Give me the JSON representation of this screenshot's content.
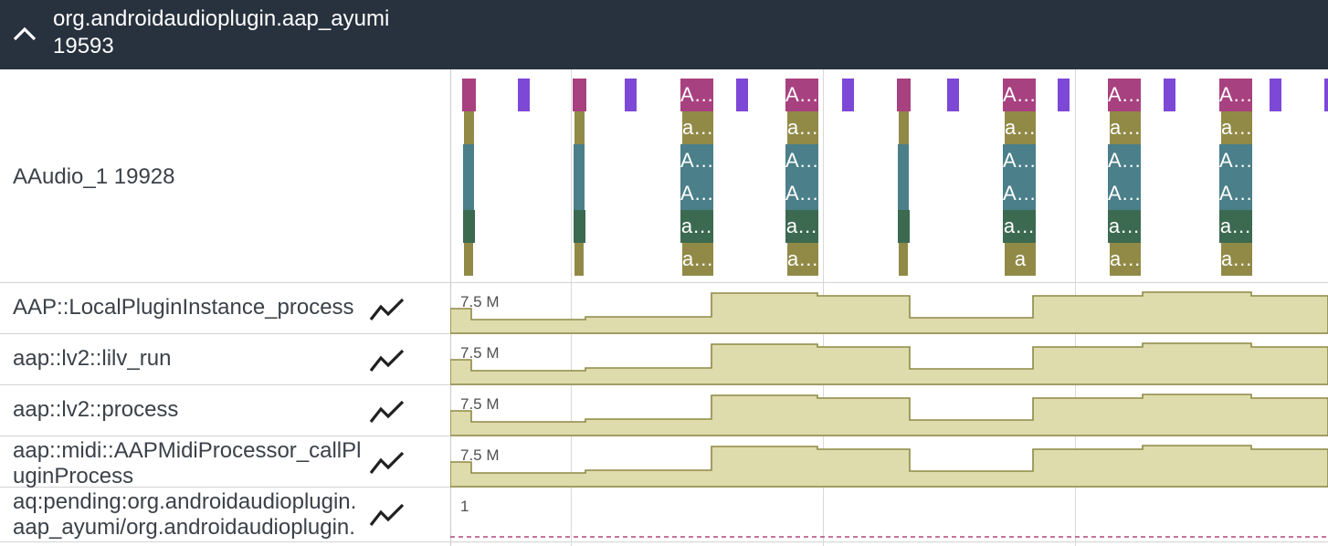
{
  "process": {
    "name": "org.androidaudioplugin.aap_ayumi",
    "pid": "19593"
  },
  "thread": {
    "label": "AAudio_1 19928",
    "colors": {
      "magenta": "#a8417f",
      "olive": "#918a47",
      "teal": "#4b7f89",
      "green": "#3c6a51",
      "purple": "#7d48d6"
    },
    "slice_texts": {
      "truncated_A": "A…",
      "truncated_a": "a…",
      "short_a": "a"
    }
  },
  "counters": [
    {
      "name": "AAP::LocalPluginInstance_process",
      "max_label": "7.5 M",
      "icon": "counter-chart-icon"
    },
    {
      "name": "aap::lv2::lilv_run",
      "max_label": "7.5 M",
      "icon": "counter-chart-icon"
    },
    {
      "name": "aap::lv2::process",
      "max_label": "7.5 M",
      "icon": "counter-chart-icon"
    },
    {
      "name": "aap::midi::AAPMidiProcessor_callPluginProcess",
      "max_label": "7.5 M",
      "icon": "counter-chart-icon"
    },
    {
      "name": "aq:pending:org.androidaudioplugin.aap_ayumi/org.androidaudioplugin.ui.",
      "max_label": "1",
      "icon": "counter-chart-icon"
    }
  ],
  "colors": {
    "header_bg": "#28323e",
    "counter_fill": "#dedbad",
    "counter_line": "#8f8a45",
    "pending_dash": "#b0457d"
  }
}
